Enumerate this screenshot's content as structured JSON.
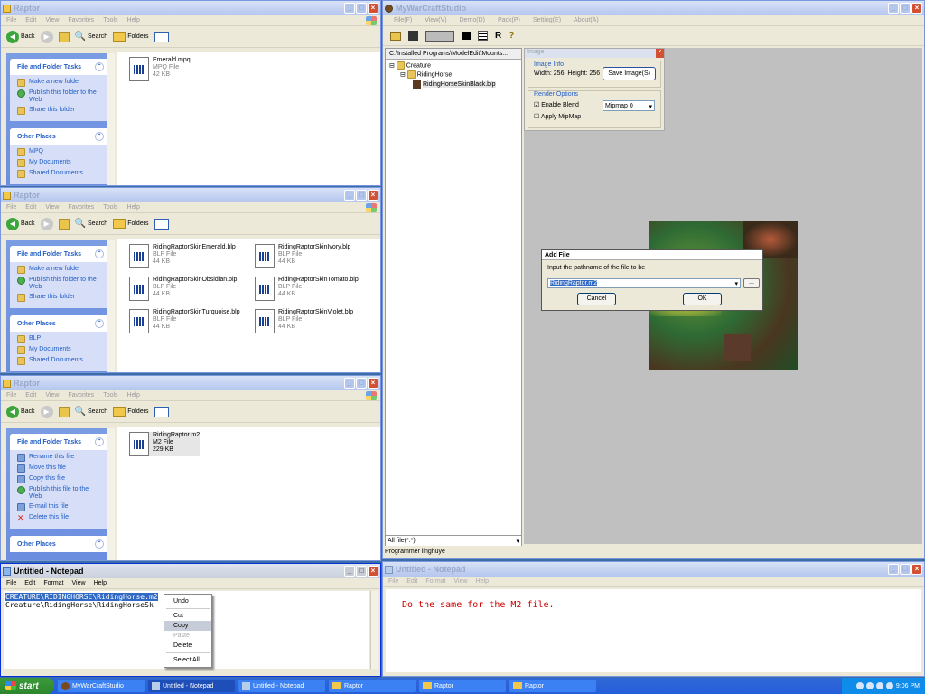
{
  "explorer_menu": [
    "File",
    "Edit",
    "View",
    "Favorites",
    "Tools",
    "Help"
  ],
  "explorer_toolbar": {
    "back": "Back",
    "search": "Search",
    "folders": "Folders"
  },
  "win1": {
    "title": "Raptor",
    "tasks_header": "File and Folder Tasks",
    "tasks": [
      "Make a new folder",
      "Publish this folder to the Web",
      "Share this folder"
    ],
    "places_header": "Other Places",
    "places": [
      "MPQ",
      "My Documents",
      "Shared Documents"
    ],
    "files": [
      {
        "name": "Emerald.mpq",
        "type": "MPQ File",
        "size": "42 KB"
      }
    ]
  },
  "win2": {
    "title": "Raptor",
    "tasks_header": "File and Folder Tasks",
    "tasks": [
      "Make a new folder",
      "Publish this folder to the Web",
      "Share this folder"
    ],
    "places_header": "Other Places",
    "places": [
      "BLP",
      "My Documents",
      "Shared Documents"
    ],
    "files": [
      {
        "name": "RidingRaptorSkinEmerald.blp",
        "type": "BLP File",
        "size": "44 KB"
      },
      {
        "name": "RidingRaptorSkinIvory.blp",
        "type": "BLP File",
        "size": "44 KB"
      },
      {
        "name": "RidingRaptorSkinObsidian.blp",
        "type": "BLP File",
        "size": "44 KB"
      },
      {
        "name": "RidingRaptorSkinTomato.blp",
        "type": "BLP File",
        "size": "44 KB"
      },
      {
        "name": "RidingRaptorSkinTurquoise.blp",
        "type": "BLP File",
        "size": "44 KB"
      },
      {
        "name": "RidingRaptorSkinViolet.blp",
        "type": "BLP File",
        "size": "44 KB"
      }
    ]
  },
  "win3": {
    "title": "Raptor",
    "tasks_header": "File and Folder Tasks",
    "tasks": [
      "Rename this file",
      "Move this file",
      "Copy this file",
      "Publish this file to the Web",
      "E-mail this file",
      "Delete this file"
    ],
    "places_header": "Other Places",
    "files": [
      {
        "name": "RidingRaptor.m2",
        "type": "M2 File",
        "size": "229 KB"
      }
    ]
  },
  "notepad1": {
    "title": "Untitled - Notepad",
    "menu": [
      "File",
      "Edit",
      "Format",
      "View",
      "Help"
    ],
    "line1": "CREATURE\\RIDINGHORSE\\RidingHorse.m2",
    "line2": "Creature\\RidingHorse\\RidingHorseSk"
  },
  "context_menu": {
    "undo": "Undo",
    "cut": "Cut",
    "copy": "Copy",
    "paste": "Paste",
    "delete": "Delete",
    "select_all": "Select All"
  },
  "mwcs": {
    "title": "MyWarCraftStudio",
    "menu": [
      "File(F)",
      "View(V)",
      "Demo(D)",
      "Pack(P)",
      "Setting(E)",
      "About(A)"
    ],
    "path": "C:\\Installed Programs\\ModelEdit\\Mounts...",
    "tree": [
      "Creature",
      "RidingHorse",
      "RidingHorseSkinBlack.blp"
    ],
    "filter": "All file(*.*)",
    "status": "Programmer linghuye",
    "image_panel": {
      "title": "Image",
      "info_label": "Image Info",
      "width_text": "Width: 256",
      "height_text": "Height: 256",
      "save_button": "Save Image(S)",
      "render_label": "Render Options",
      "enable_blend": "Enable Blend",
      "mipmap": "Mipmap 0",
      "apply_mipmap": "Apply MipMap"
    }
  },
  "add_file_dialog": {
    "title": "Add File",
    "prompt": "Input the pathname of the file to be",
    "value": "RidingRaptor.m2",
    "browse": "...",
    "cancel": "Cancel",
    "ok": "OK"
  },
  "notepad2": {
    "title": "Untitled - Notepad",
    "menu": [
      "File",
      "Edit",
      "Format",
      "View",
      "Help"
    ],
    "text": "Do the same for the M2 file."
  },
  "taskbar": {
    "start": "start",
    "tasks": [
      "MyWarCraftStudio",
      "Untitled - Notepad",
      "Untitled - Notepad",
      "Raptor",
      "Raptor",
      "Raptor"
    ],
    "clock": "9:06 PM"
  },
  "colors": {
    "xp_blue": "#0a4ec8",
    "annotation_red": "#cc0000",
    "mwcs_bg": "#c0c0c0"
  }
}
